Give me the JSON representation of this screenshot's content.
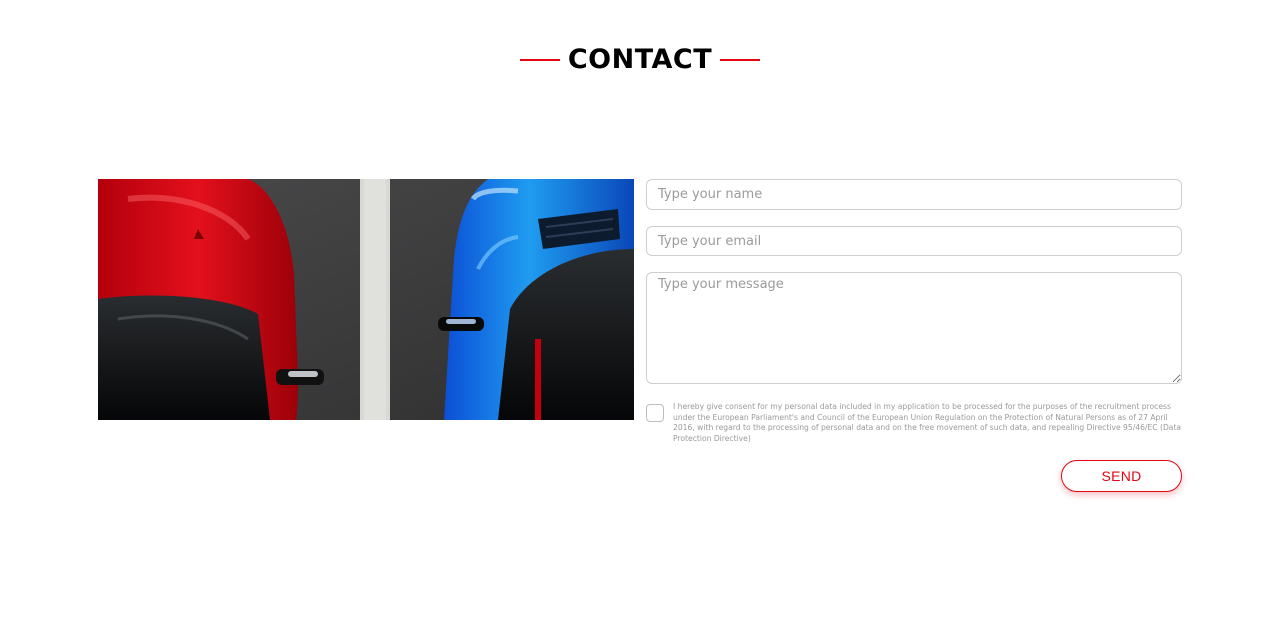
{
  "section": {
    "title": "CONTACT",
    "accent_color": "#e30613"
  },
  "image": {
    "description_icon": "parked-cars-photo"
  },
  "form": {
    "name_placeholder": "Type your name",
    "email_placeholder": "Type your email",
    "message_placeholder": "Type your message",
    "consent_text": "I hereby give consent for my personal data included in my application to be processed for the purposes of the recruitment process under the European Parliament's and Council of the European Union Regulation on the Protection of Natural Persons as of 27 April 2016, with regard to the processing of personal data and on the free movement of such data, and repealing Directive 95/46/EC (Data Protection Directive)",
    "send_label": "SEND"
  }
}
